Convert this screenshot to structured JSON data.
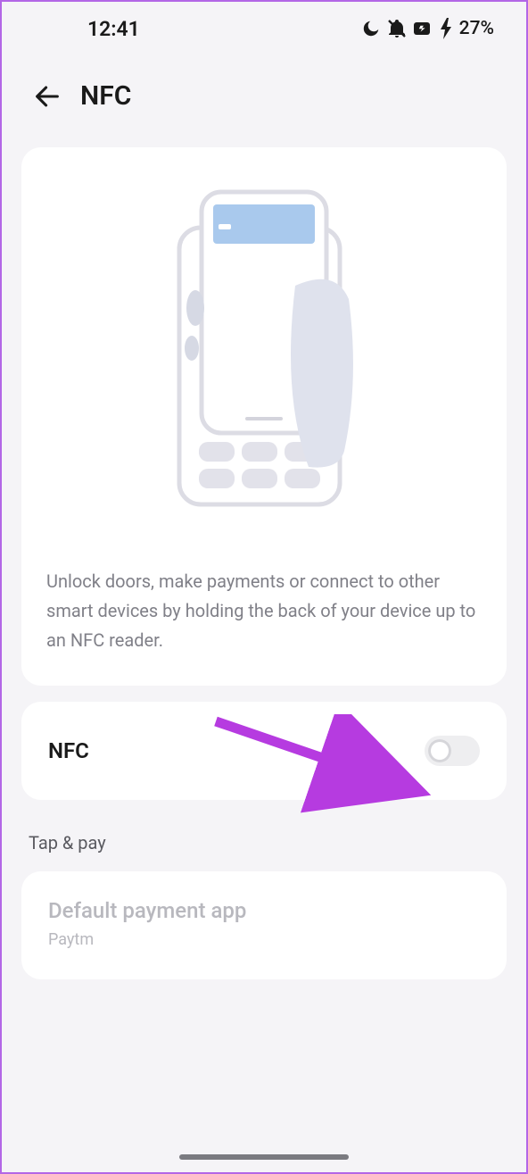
{
  "status": {
    "time": "12:41",
    "battery_pct": "27%"
  },
  "header": {
    "title": "NFC"
  },
  "info": {
    "description": "Unlock doors, make payments or connect to other smart devices by holding the back of your device up to an NFC reader."
  },
  "toggle": {
    "label": "NFC",
    "enabled": false
  },
  "section": {
    "tap_pay": "Tap & pay"
  },
  "payment": {
    "title": "Default payment app",
    "value": "Paytm"
  },
  "colors": {
    "annotation_arrow": "#b63be0"
  }
}
